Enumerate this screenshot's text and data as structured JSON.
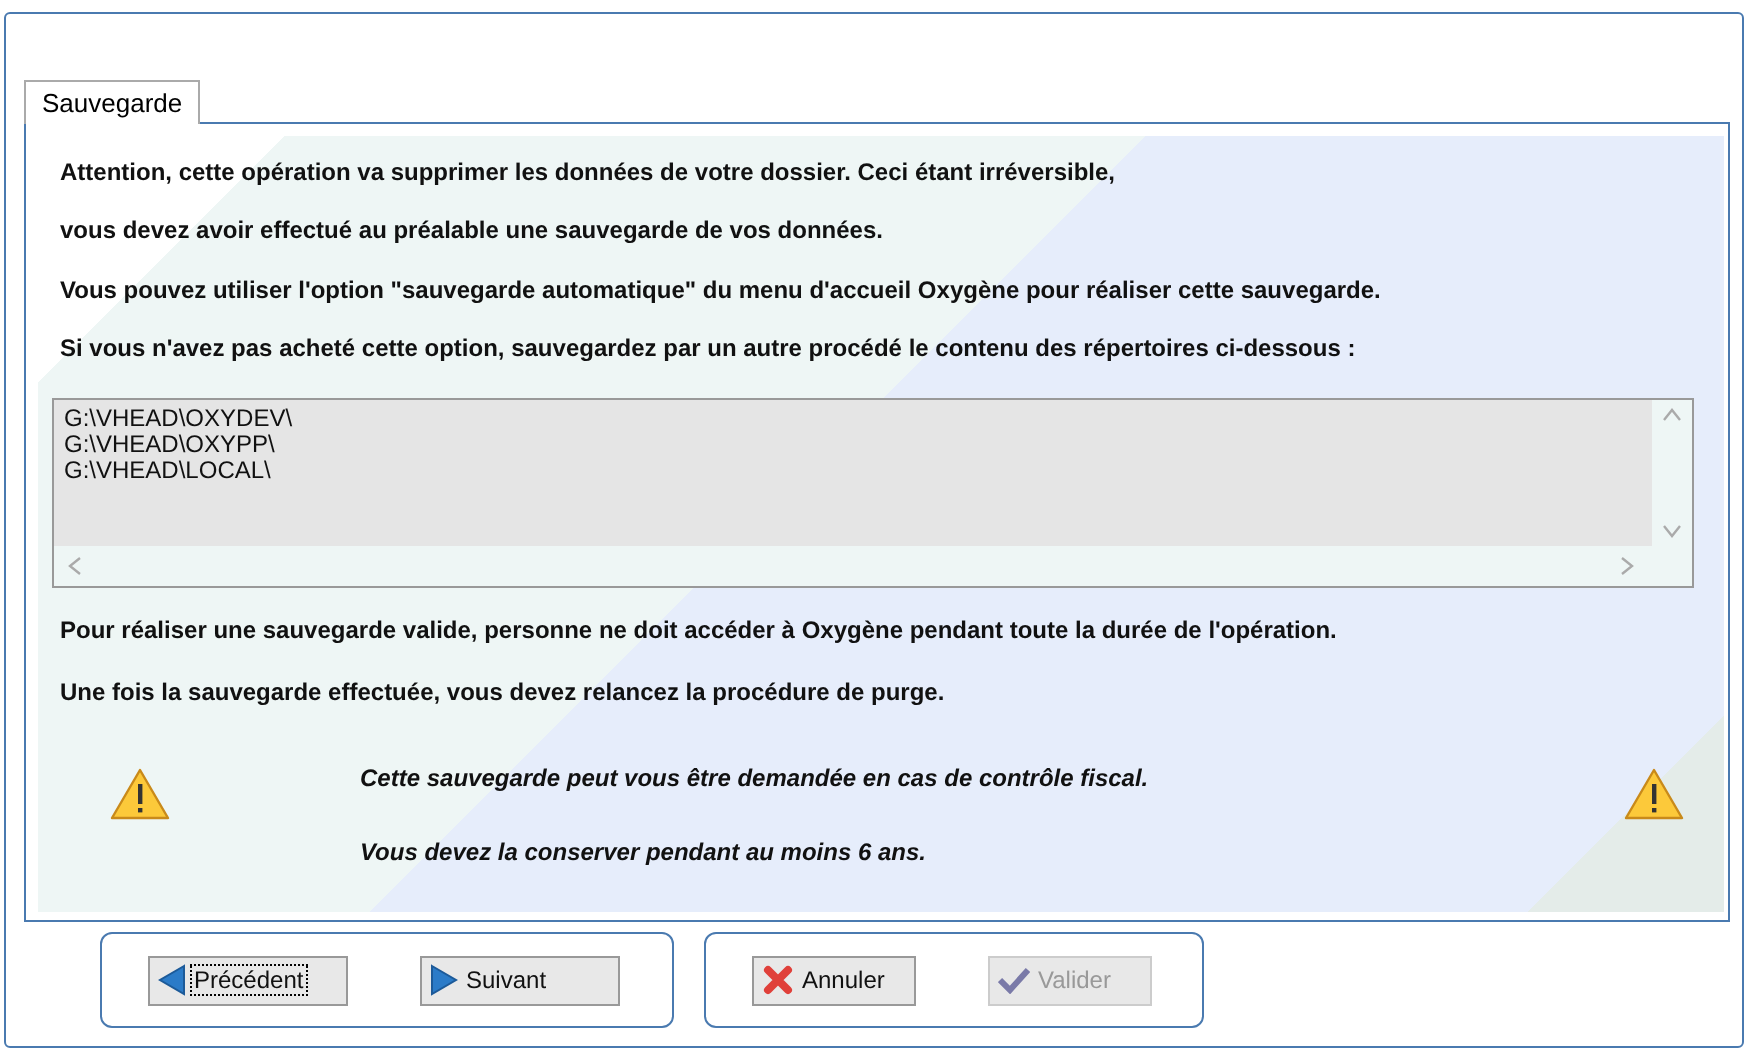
{
  "tabs": [
    {
      "label": "Sauvegarde",
      "selected": true
    }
  ],
  "intro": [
    "Attention, cette opération va supprimer les données de votre dossier. Ceci étant irréversible,",
    "vous devez avoir effectué au préalable une sauvegarde de vos données.",
    "Vous pouvez utiliser l'option \"sauvegarde automatique\" du menu d'accueil Oxygène pour réaliser cette sauvegarde.",
    "Si vous n'avez pas acheté cette option, sauvegardez par un autre procédé le contenu des répertoires ci-dessous :"
  ],
  "directories": [
    "G:\\VHEAD\\OXYDEV\\",
    "G:\\VHEAD\\OXYPP\\",
    "G:\\VHEAD\\LOCAL\\"
  ],
  "notes": [
    "Pour réaliser une sauvegarde valide, personne ne doit accéder à Oxygène pendant toute la durée de l'opération.",
    "Une fois la sauvegarde effectuée, vous devez relancez la procédure de purge."
  ],
  "warnings": [
    "Cette sauvegarde peut vous être demandée en cas de contrôle fiscal.",
    "Vous devez la conserver pendant au moins 6 ans."
  ],
  "button_groups": [
    [
      {
        "label": "Précédent",
        "kind": "back",
        "disabled": false,
        "focused": true
      },
      {
        "label": "Suivant",
        "kind": "next",
        "disabled": false,
        "focused": false
      }
    ],
    [
      {
        "label": "Annuler",
        "kind": "cancel",
        "disabled": false,
        "focused": false
      },
      {
        "label": "Valider",
        "kind": "validate",
        "disabled": true,
        "focused": false
      }
    ]
  ]
}
